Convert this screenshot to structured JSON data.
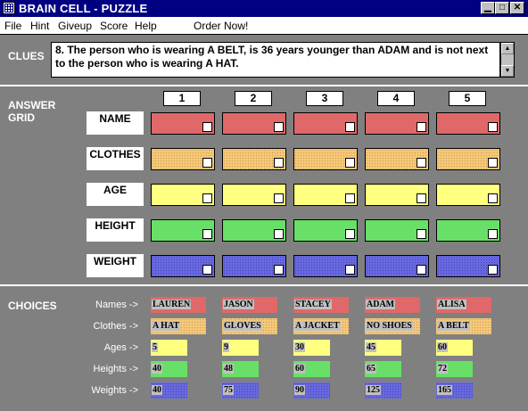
{
  "window": {
    "title": "BRAIN CELL - PUZZLE",
    "controls": [
      "minimize",
      "maximize",
      "close"
    ]
  },
  "menu": {
    "file": "File",
    "hint": "Hint",
    "giveup": "Giveup",
    "score": "Score",
    "help": "Help",
    "order": "Order Now!"
  },
  "clues": {
    "label": "CLUES",
    "text": "8. The person who is wearing A BELT, is  36 years younger than ADAM and is not next to the person who is wearing A HAT."
  },
  "answer_grid": {
    "label_line1": "ANSWER",
    "label_line2": "GRID",
    "columns": [
      "1",
      "2",
      "3",
      "4",
      "5"
    ],
    "rows": [
      {
        "label": "NAME",
        "color": "#e06868"
      },
      {
        "label": "CLOTHES",
        "color": "#f5c878"
      },
      {
        "label": "AGE",
        "color": "#ffff80"
      },
      {
        "label": "HEIGHT",
        "color": "#68e068"
      },
      {
        "label": "WEIGHT",
        "color": "#6868e0"
      }
    ]
  },
  "choices": {
    "label": "CHOICES",
    "rows": [
      {
        "label": "Names ->",
        "items": [
          "LAUREN",
          "JASON",
          "STACEY",
          "ADAM",
          "ALISA"
        ]
      },
      {
        "label": "Clothes ->",
        "items": [
          "A HAT",
          "GLOVES",
          "A JACKET",
          "NO SHOES",
          "A BELT"
        ]
      },
      {
        "label": "Ages ->",
        "items": [
          "5",
          "9",
          "30",
          "45",
          "60"
        ]
      },
      {
        "label": "Heights ->",
        "items": [
          "40",
          "48",
          "60",
          "65",
          "72"
        ]
      },
      {
        "label": "Weights ->",
        "items": [
          "40",
          "75",
          "90",
          "125",
          "165"
        ]
      }
    ]
  }
}
